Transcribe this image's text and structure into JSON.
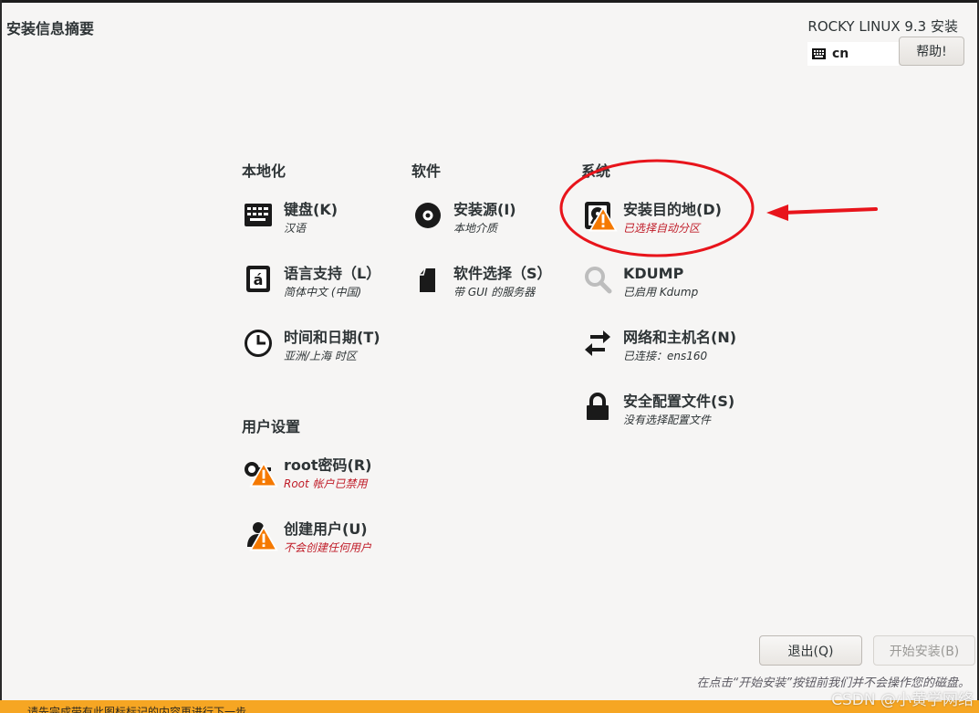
{
  "header": {
    "page_title": "安装信息摘要",
    "product_title": "ROCKY LINUX 9.3 安装",
    "keyboard_layout": "cn",
    "help_label": "帮助!"
  },
  "sections": {
    "localization": "本地化",
    "software": "软件",
    "system": "系统",
    "user_settings": "用户设置"
  },
  "spokes": {
    "keyboard": {
      "title": "键盘(K)",
      "status": "汉语",
      "icon": "keyboard-icon"
    },
    "language": {
      "title": "语言支持（L）",
      "status": "简体中文 (中国)",
      "icon": "language-icon"
    },
    "datetime": {
      "title": "时间和日期(T)",
      "status": "亚洲/上海 时区",
      "icon": "clock-icon"
    },
    "source": {
      "title": "安装源(I)",
      "status": "本地介质",
      "icon": "disc-icon"
    },
    "software": {
      "title": "软件选择（S）",
      "status": "带 GUI 的服务器",
      "icon": "package-icon"
    },
    "destination": {
      "title": "安装目的地(D)",
      "status": "已选择自动分区",
      "icon": "harddisk-icon",
      "warning": true
    },
    "kdump": {
      "title": "KDUMP",
      "status": "已启用 Kdump",
      "icon": "magnifier-icon"
    },
    "network": {
      "title": "网络和主机名(N)",
      "status": "已连接：ens160",
      "icon": "network-arrows-icon"
    },
    "security": {
      "title": "安全配置文件(S)",
      "status": "没有选择配置文件",
      "icon": "lock-icon"
    },
    "root": {
      "title": "root密码(R)",
      "status": "Root 帐户已禁用",
      "icon": "key-icon",
      "warning": true
    },
    "user": {
      "title": "创建用户(U)",
      "status": "不会创建任何用户",
      "icon": "user-icon",
      "warning": true
    }
  },
  "footer": {
    "quit_label": "退出(Q)",
    "begin_label": "开始安装(B)",
    "note": "在点击“开始安装”按钮前我们并不会操作您的磁盘。",
    "warning_bar": "请先完成带有此图标标记的内容再进行下一步。",
    "watermark": "CSDN @小黄学网络"
  },
  "colors": {
    "background": "#f6f5f4",
    "warning_text": "#c01c28",
    "warning_bar": "#f6a623",
    "annotation": "#e8141b"
  }
}
